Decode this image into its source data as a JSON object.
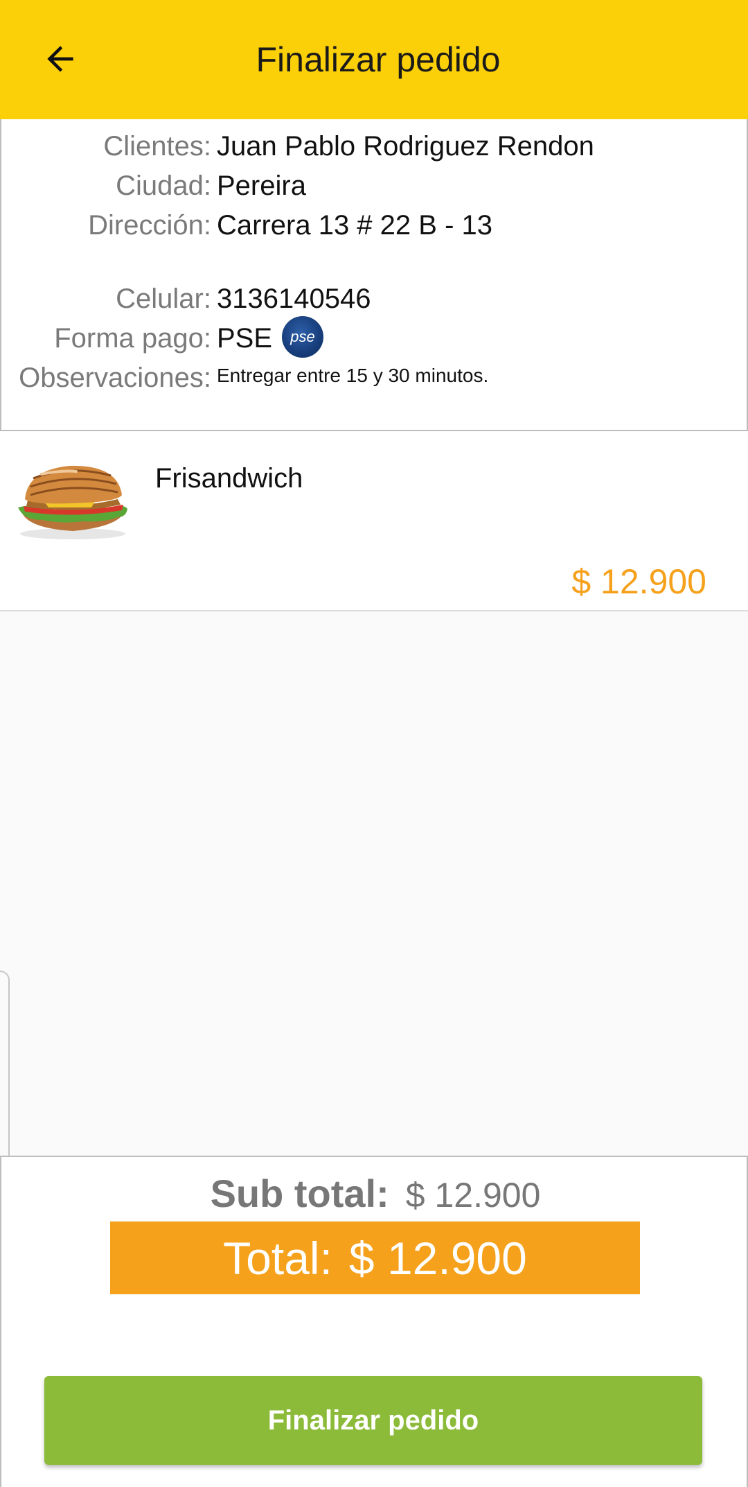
{
  "header": {
    "title": "Finalizar pedido",
    "back_icon": "arrow-left-icon"
  },
  "customer": {
    "rows": [
      {
        "label": "Clientes:",
        "value": "Juan Pablo  Rodriguez Rendon"
      },
      {
        "label": "Ciudad:",
        "value": "Pereira"
      },
      {
        "label": "Dirección:",
        "value": "Carrera 13 # 22 B - 13"
      },
      {
        "label": "Celular:",
        "value": "3136140546"
      },
      {
        "label": "Forma pago:",
        "value": "PSE"
      },
      {
        "label": "Observaciones:",
        "value": "Entregar entre 15 y 30 minutos."
      }
    ],
    "payment_logo_text": "pse"
  },
  "order_item": {
    "name": "Frisandwich",
    "price": "$ 12.900"
  },
  "summary": {
    "subtotal_label": "Sub total:",
    "subtotal_value": "$ 12.900",
    "total_label": "Total:",
    "total_value": "$ 12.900"
  },
  "actions": {
    "finalize_label": "Finalizar pedido"
  },
  "colors": {
    "appbar": "#fcd009",
    "accent_orange": "#f5a11c",
    "button_green": "#8cbb3a"
  }
}
